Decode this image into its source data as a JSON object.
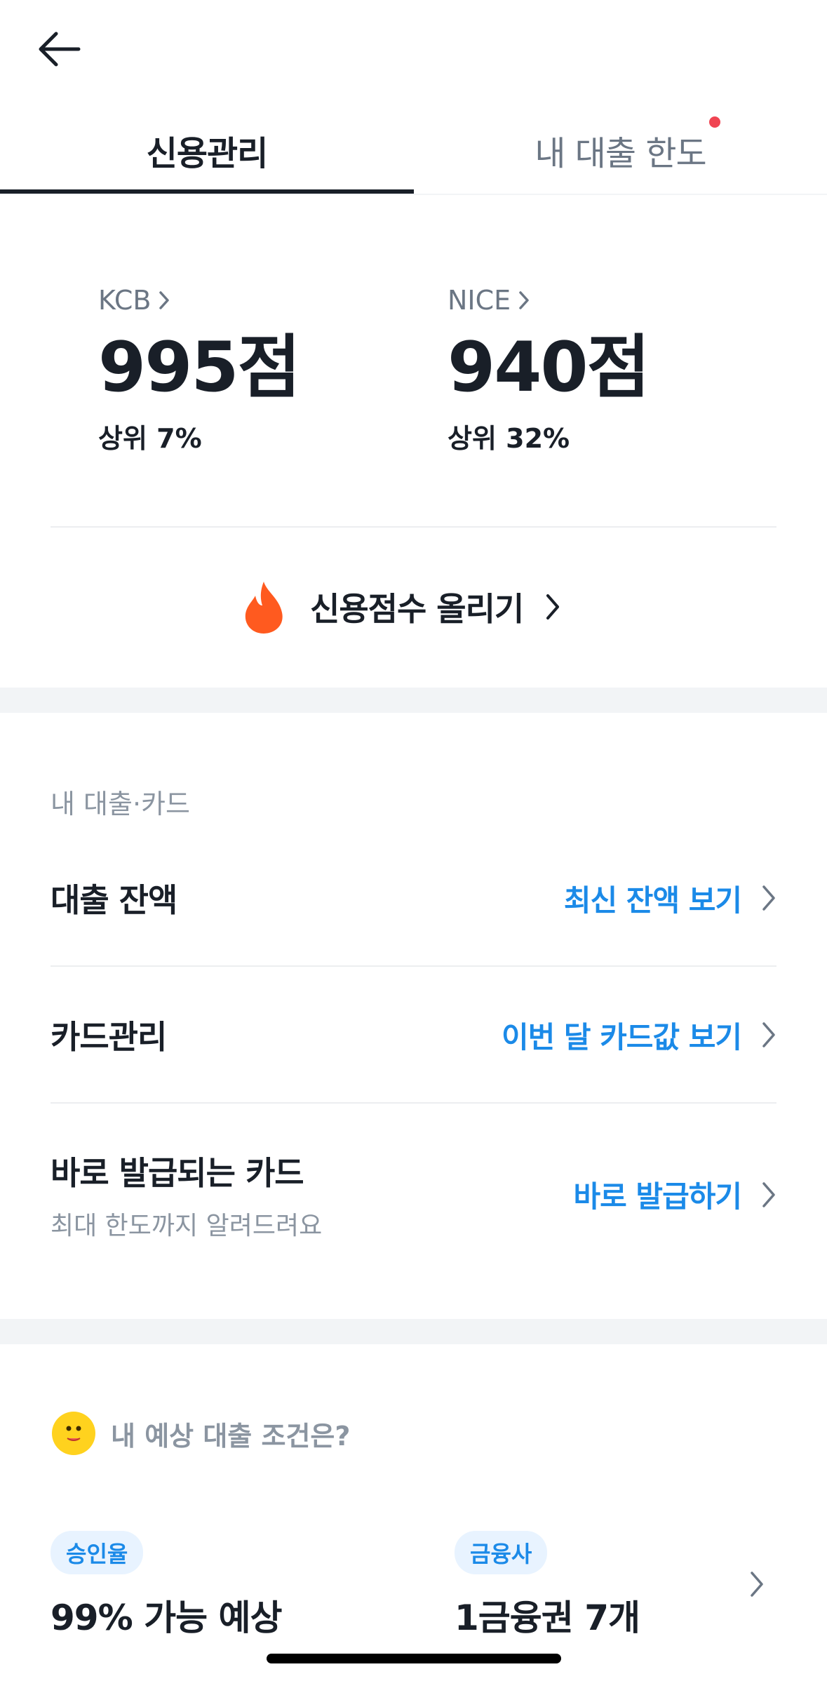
{
  "tabs": [
    {
      "label": "신용관리",
      "active": true
    },
    {
      "label": "내 대출 한도",
      "badge": true
    }
  ],
  "scores": {
    "kcb": {
      "bureau": "KCB",
      "value": "995점",
      "rank": "상위 7%"
    },
    "nice": {
      "bureau": "NICE",
      "value": "940점",
      "rank": "상위 32%"
    }
  },
  "raise_score": {
    "label": "신용점수 올리기"
  },
  "loans_cards": {
    "title": "내 대출·카드",
    "rows": [
      {
        "label": "대출 잔액",
        "action": "최신 잔액 보기"
      },
      {
        "label": "카드관리",
        "action": "이번 달 카드값 보기"
      },
      {
        "label": "바로 발급되는 카드",
        "sub": "최대 한도까지 알려드려요",
        "action": "바로 발급하기"
      }
    ]
  },
  "expected_loan": {
    "title": "내 예상 대출 조건은?",
    "conditions": [
      {
        "chip": "승인율",
        "value": "99% 가능 예상"
      },
      {
        "chip": "금융사",
        "value": "1금융권 7개"
      }
    ]
  },
  "colors": {
    "accent": "#1b8ae8",
    "text": "#191f28",
    "subtext": "#8b95a1",
    "badge": "#f04452",
    "flame": "#ff5a1f"
  },
  "icons": {
    "back": "arrow-left-icon",
    "chevron": "chevron-right-icon",
    "flame": "flame-icon",
    "mascot": "mascot-face-icon"
  }
}
